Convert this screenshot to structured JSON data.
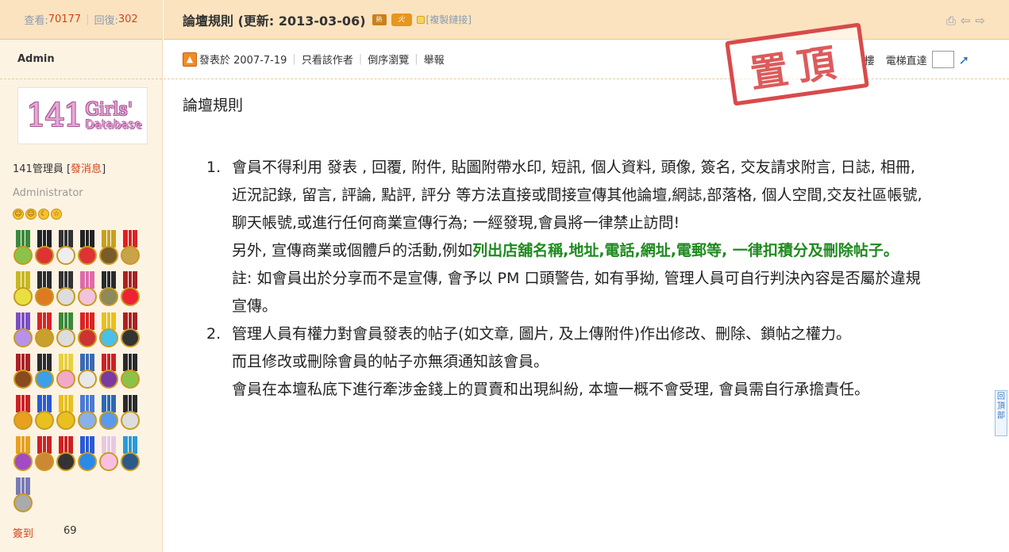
{
  "sidebar": {
    "views_label": "查看:",
    "views_count": "70177",
    "replies_label": "回復:",
    "replies_count": "302",
    "author": "Admin",
    "logo": {
      "num": "141",
      "word1": "Girls'",
      "word2": "Database"
    },
    "title_text": "141管理員",
    "send_message": "發消息",
    "role": "Administrator",
    "signin_label": "簽到",
    "signin_count": "69"
  },
  "header": {
    "title": "論壇規則 (更新: 2013-03-06)",
    "tag_hot": "熱",
    "tag_fire": "火",
    "copy_link": "[複製鏈接]"
  },
  "postbar": {
    "posted": "發表於 2007-7-19",
    "only_author": "只看該作者",
    "reverse": "倒序瀏覽",
    "report": "舉報",
    "floor_label": "樓",
    "elevator": "電梯直達"
  },
  "stamp": {
    "text": "置頂"
  },
  "post": {
    "heading": "論壇規則",
    "rule1_num": "1.",
    "rule1_text": "會員不得利用 發表 , 回覆, 附件, 貼圖附帶水印, 短訊, 個人資料, 頭像, 簽名, 交友請求附言, 日誌, 相冊, 近況記錄, 留言, 評論, 點評, 評分 等方法直接或間接宣傳其他論壇,網誌,部落格, 個人空間,交友社區帳號,聊天帳號,或進行任何商業宣傳行為; 一經發現,會員將一律禁止訪問!",
    "rule1_extra_prefix": "另外, 宣傳商業或個體戶的活動,例如",
    "rule1_extra_green": "列出店舖名稱,地址,電話,網址,電郵等, 一律扣積分及刪除帖子。",
    "rule1_note": "註: 如會員出於分享而不是宣傳, 會予以 PM 口頭警告, 如有爭拗, 管理人員可自行判決內容是否屬於違規宣傳。",
    "rule2_num": "2.",
    "rule2_text": "管理人員有權力對會員發表的帖子(如文章, 圖片, 及上傳附件)作出修改、刪除、鎖帖之權力。",
    "rule2_line2": "而且修改或刪除會員的帖子亦無須通知該會員。",
    "rule2_line3": "會員在本壇私底下進行牽涉金錢上的買賣和出現糾紛, 本壇一概不會受理, 會員需自行承擔責任。"
  },
  "back_top": "回頂部",
  "colors": {
    "accent": "#d0451b",
    "green": "#1e8a1e",
    "stamp": "#d94a4a"
  }
}
